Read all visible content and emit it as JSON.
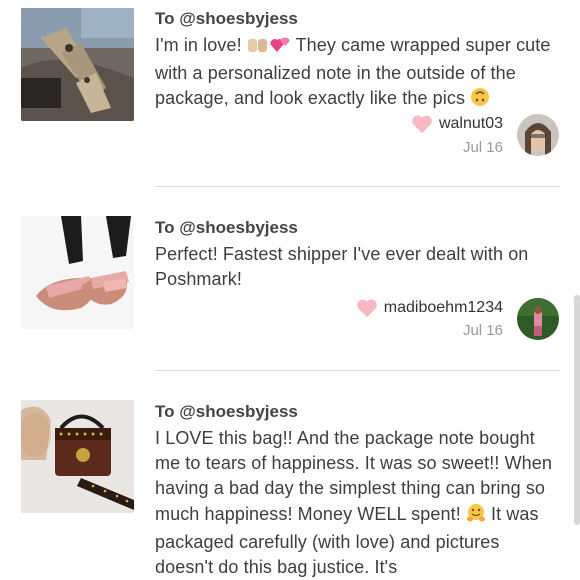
{
  "reviews": [
    {
      "to": "To @shoesbyjess",
      "message_pre": "I'm in love! ",
      "message_post": " They came wrapped super cute with a personalized note in the outside of the package, and look exactly like the pics ",
      "username": "walnut03",
      "date": "Jul 16",
      "image": "sandals-snake-print"
    },
    {
      "to": "To @shoesbyjess",
      "message": "Perfect! Fastest shipper I've ever dealt with on Poshmark!",
      "username": "madiboehm1234",
      "date": "Jul 16",
      "image": "pink-slide-sandals"
    },
    {
      "to": "To @shoesbyjess",
      "message_a": "I LOVE this bag!! And the package note bought me to tears of happiness. It was so sweet!! When having a bad day the simplest thing can bring so much happiness! Money WELL spent! ",
      "message_b": " It was packaged carefully (with love) and pictures doesn't do this bag justice. It's",
      "image": "brown-studded-handbag"
    }
  ],
  "colors": {
    "heart": "#f7b8c4",
    "divider": "#dedede",
    "date": "#9a9a9a"
  }
}
